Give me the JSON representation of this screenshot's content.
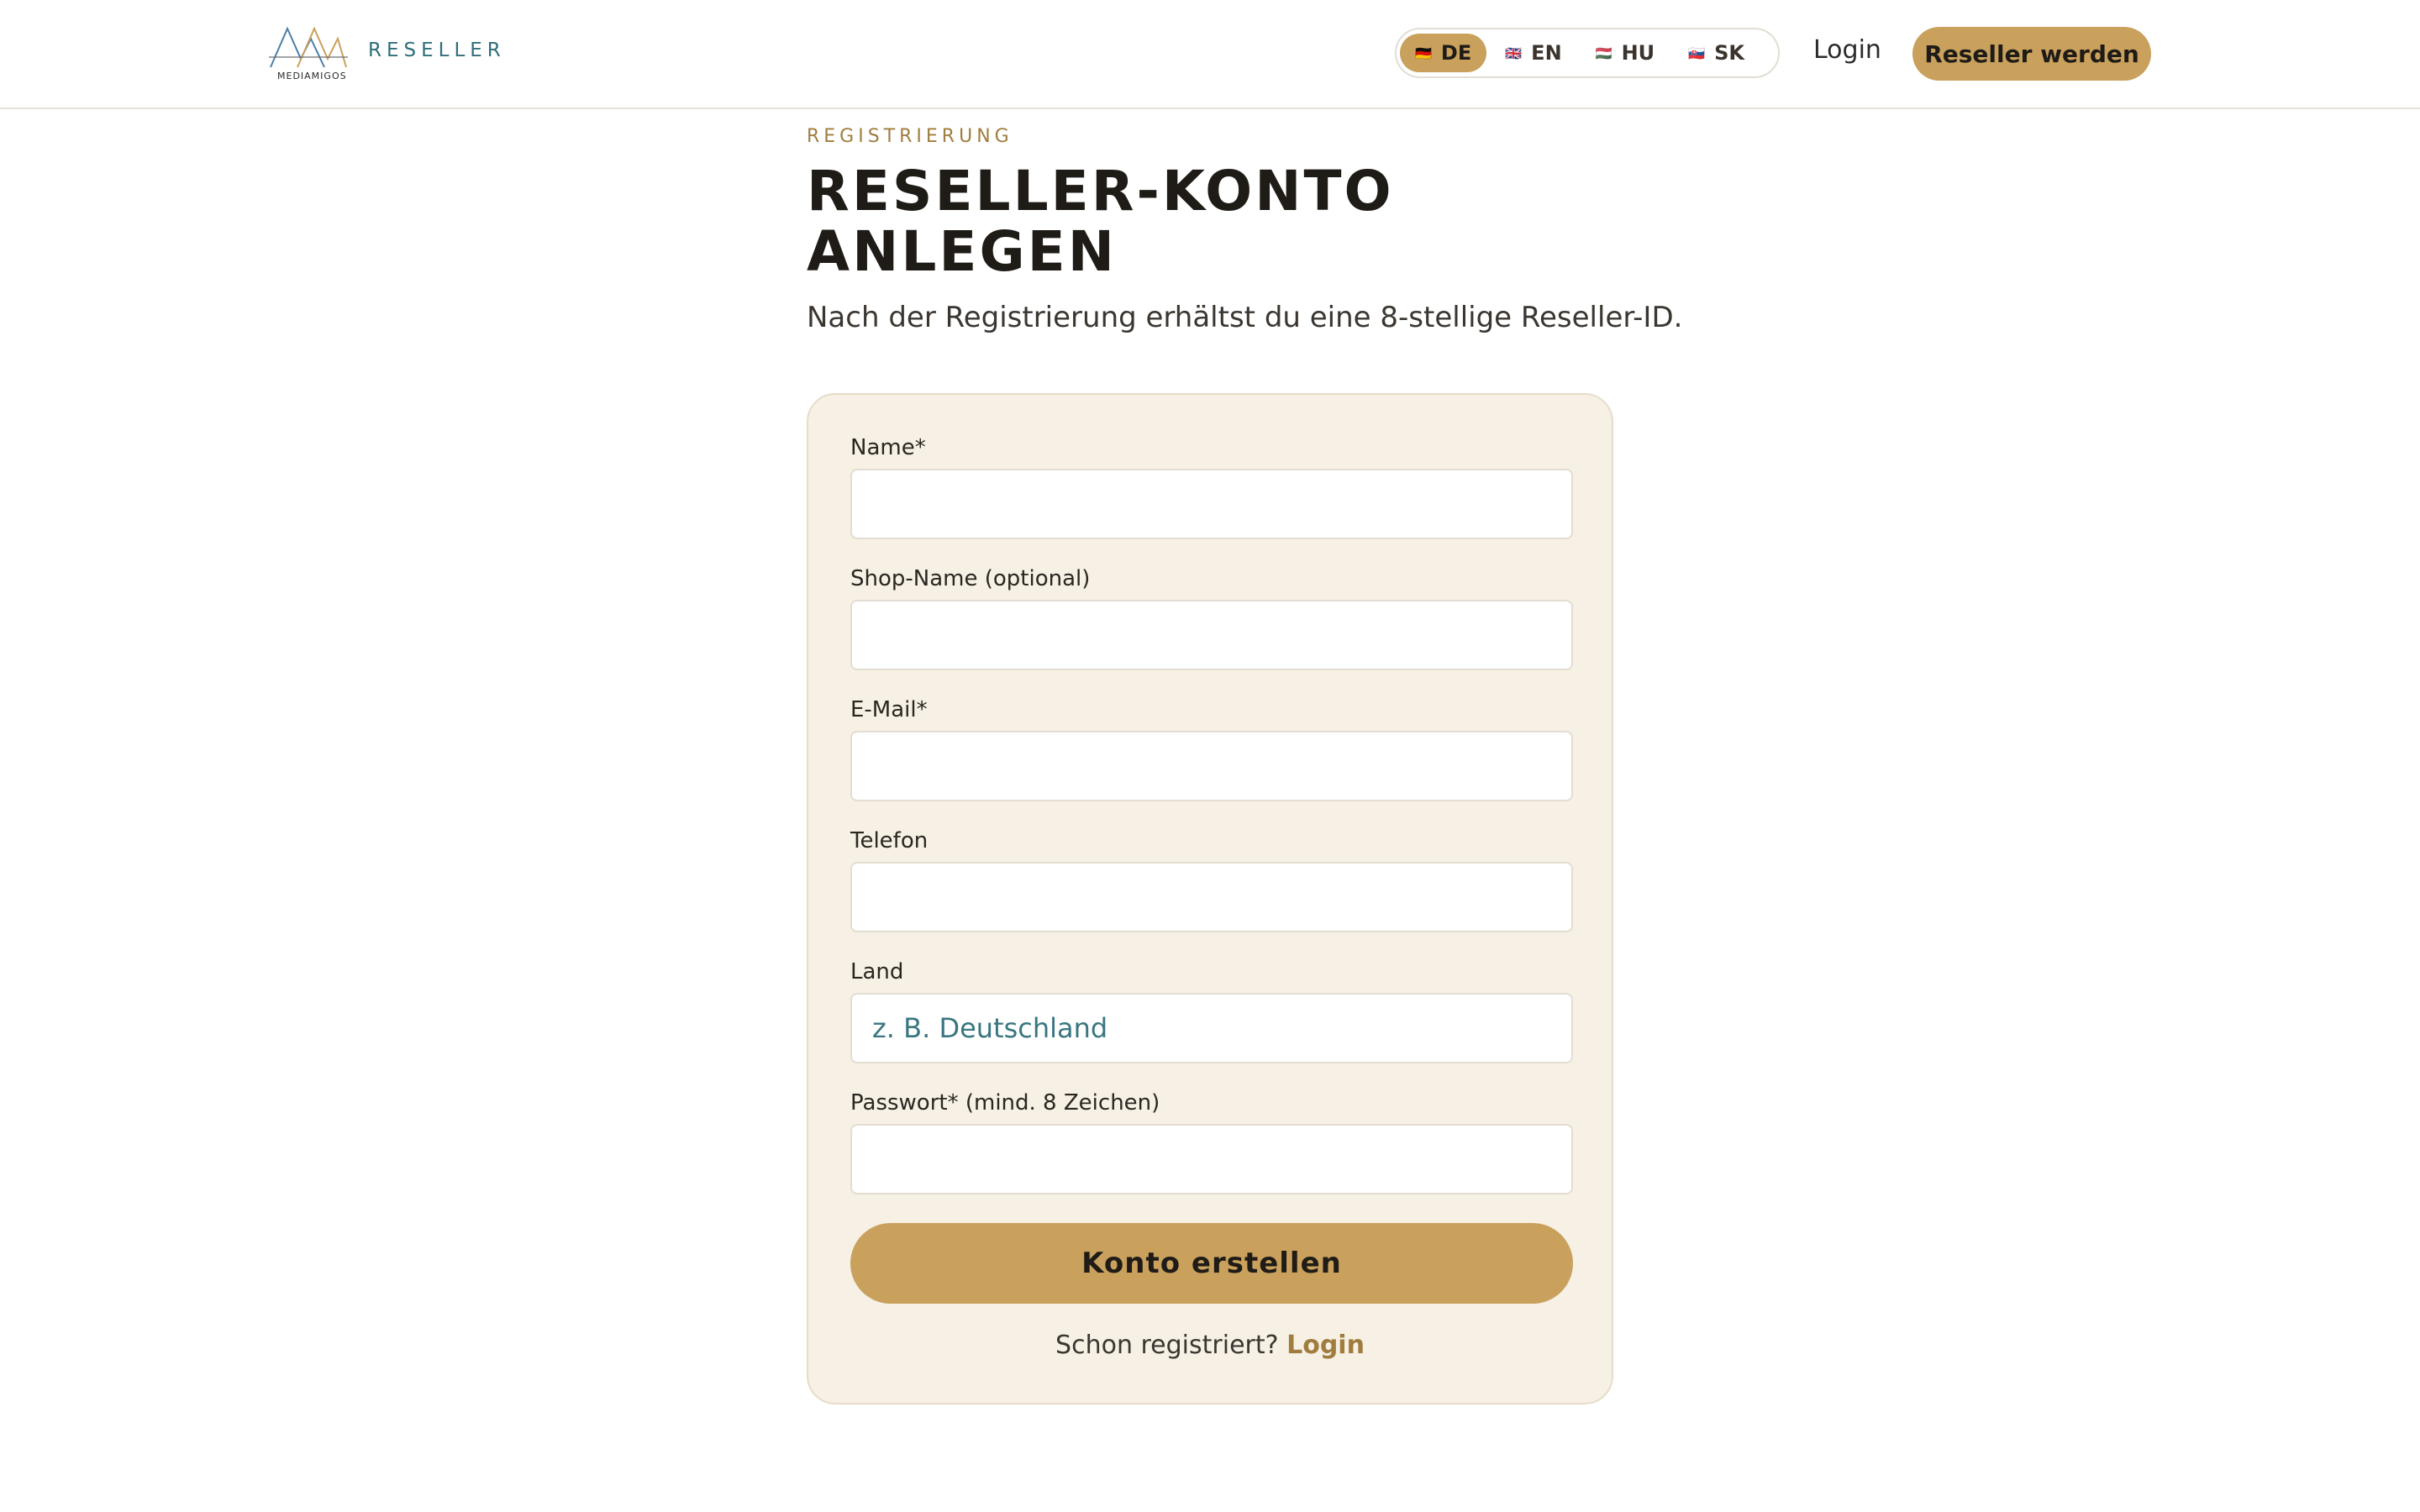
{
  "header": {
    "logo": {
      "mark_text": "MEDIAMIGOS",
      "brand_text": "RESELLER"
    },
    "languages": [
      {
        "flag": "🇩🇪",
        "code": "DE",
        "active": true
      },
      {
        "flag": "🇬🇧",
        "code": "EN",
        "active": false
      },
      {
        "flag": "🇭🇺",
        "code": "HU",
        "active": false
      },
      {
        "flag": "🇸🇰",
        "code": "SK",
        "active": false
      }
    ],
    "login_label": "Login",
    "cta_label": "Reseller werden"
  },
  "main": {
    "eyebrow": "REGISTRIERUNG",
    "title_line1": "RESELLER-KONTO",
    "title_line2": "ANLEGEN",
    "subtitle": "Nach der Registrierung erhältst du eine 8-stellige Reseller-ID."
  },
  "form": {
    "fields": [
      {
        "label": "Name*",
        "value": "",
        "placeholder": ""
      },
      {
        "label": "Shop-Name (optional)",
        "value": "",
        "placeholder": ""
      },
      {
        "label": "E-Mail*",
        "value": "",
        "placeholder": ""
      },
      {
        "label": "Telefon",
        "value": "",
        "placeholder": ""
      },
      {
        "label": "Land",
        "value": "",
        "placeholder": "z. B. Deutschland"
      },
      {
        "label": "Passwort* (mind. 8 Zeichen)",
        "value": "",
        "placeholder": ""
      }
    ],
    "submit_label": "Konto erstellen",
    "login_hint": "Schon registriert?",
    "login_link": "Login"
  },
  "colors": {
    "accent": "#c9a15d",
    "accent_text": "#a07d3e",
    "brand_teal": "#2f6f7a",
    "card_bg": "#f6f0e5"
  }
}
